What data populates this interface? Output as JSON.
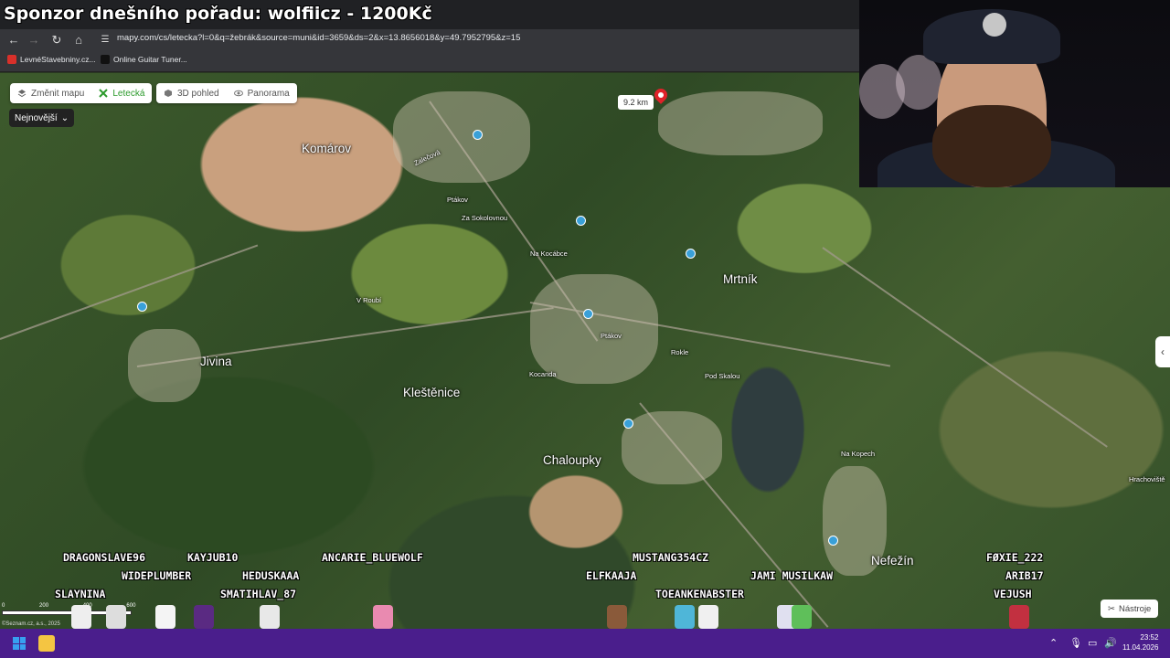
{
  "stream": {
    "sponsor_text": "Sponzor dnešního pořadu: wolfiicz - 1200Kč"
  },
  "browser": {
    "url": "mapy.com/cs/letecka?l=0&q=žebrák&source=muni&id=3659&ds=2&x=13.8656018&y=49.7952795&z=15",
    "bookmarks": [
      {
        "label": "LevnéStavebniny.cz...",
        "icon": "ls-favicon",
        "color": "#d8302a"
      },
      {
        "label": "Online Guitar Tuner...",
        "icon": "guitar-favicon",
        "color": "#222222"
      }
    ]
  },
  "map": {
    "controls": {
      "change_map": "Změnit mapu",
      "aerial": "Letecká",
      "view3d": "3D pohled",
      "panorama": "Panorama"
    },
    "dropdown": "Nejnovější",
    "distance": "9.2 km",
    "tools": "Nástroje",
    "scale_labels": [
      "0",
      "200",
      "400",
      "600"
    ],
    "copyright": "©Seznam.cz, a.s., 2025",
    "places_big": [
      "Komárov",
      "Mrtník",
      "Jivina",
      "Kleštěnice",
      "Chaloupky",
      "Nefežín"
    ],
    "places_small": [
      "Zalečová",
      "Ptákov",
      "Za Sokolovnou",
      "Na Kocábce",
      "Na Kocábce",
      "V Roubí",
      "Ptákov",
      "Rokle",
      "Kocanda",
      "Pod Skalou",
      "Na Kopech",
      "Hrachoviště"
    ]
  },
  "chat_names": [
    "DRAGONSLAVE96",
    "KAYJUB10",
    "ANCARIE_BLUEWOLF",
    "MUSTANG354CZ",
    "FØXIE_222",
    "SLAYNINA",
    "WIDEPLUMBER",
    "HEDUSKAAA",
    "ELFKAAJA",
    "JAMI MUSILKAW",
    "ARIB17",
    "SMATIHLAV_87",
    "TOEANKENABSTER",
    "VEJUSH"
  ],
  "taskbar": {
    "time": "23:52",
    "date": "11.04.2026"
  }
}
